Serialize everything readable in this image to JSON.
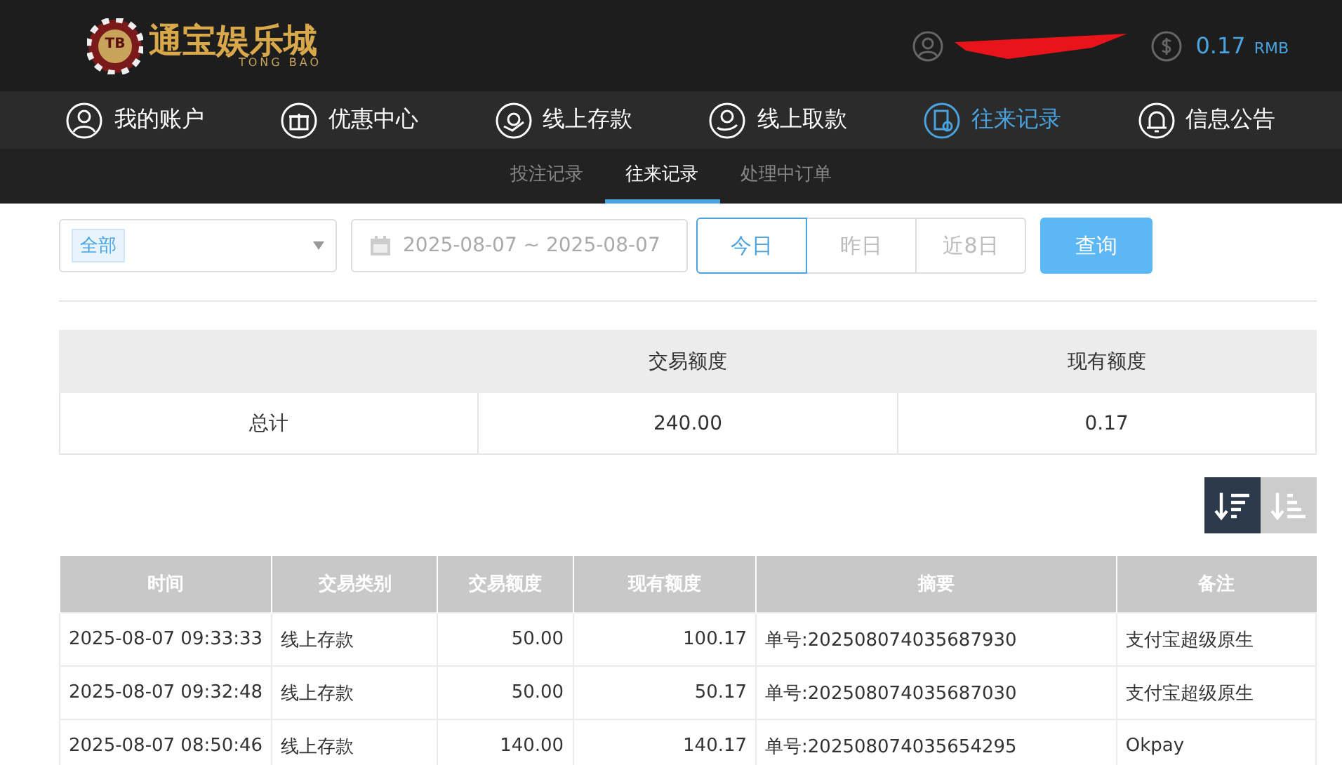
{
  "header": {
    "logo": {
      "badge": "TB",
      "title": "通宝娱乐城",
      "subtitle": "TONG BAO"
    },
    "balance": "0.17",
    "currency": "RMB"
  },
  "nav": [
    {
      "label": "我的账户",
      "kind": "user",
      "selected": false
    },
    {
      "label": "优惠中心",
      "kind": "gift",
      "selected": false
    },
    {
      "label": "线上存款",
      "kind": "deposit",
      "selected": false
    },
    {
      "label": "线上取款",
      "kind": "withdraw",
      "selected": false
    },
    {
      "label": "往来记录",
      "kind": "record",
      "selected": true
    },
    {
      "label": "信息公告",
      "kind": "bell",
      "selected": false
    }
  ],
  "subnav": [
    {
      "label": "投注记录",
      "selected": false
    },
    {
      "label": "往来记录",
      "selected": true
    },
    {
      "label": "处理中订单",
      "selected": false
    }
  ],
  "filters": {
    "type_tag": "全部",
    "date_range": "2025-08-07 ~ 2025-08-07",
    "quick": [
      {
        "label": "今日",
        "selected": true
      },
      {
        "label": "昨日",
        "selected": false
      },
      {
        "label": "近8日",
        "selected": false
      }
    ],
    "query_button": "查询"
  },
  "summary": {
    "columns": [
      "交易额度",
      "现有额度"
    ],
    "row": {
      "label": "总计",
      "values": [
        "240.00",
        "0.17"
      ]
    }
  },
  "sort": [
    {
      "kind": "desc",
      "selected": true
    },
    {
      "kind": "asc",
      "selected": false
    }
  ],
  "table": {
    "columns": [
      "时间",
      "交易类别",
      "交易额度",
      "现有额度",
      "摘要",
      "备注"
    ],
    "rows": [
      [
        "2025-08-07 09:33:33",
        "线上存款",
        "50.00",
        "100.17",
        "单号:202508074035687930",
        "支付宝超级原生"
      ],
      [
        "2025-08-07 09:32:48",
        "线上存款",
        "50.00",
        "50.17",
        "单号:202508074035687030",
        "支付宝超级原生"
      ],
      [
        "2025-08-07 08:50:46",
        "线上存款",
        "140.00",
        "140.17",
        "单号:202508074035654295",
        "Okpay"
      ]
    ]
  }
}
